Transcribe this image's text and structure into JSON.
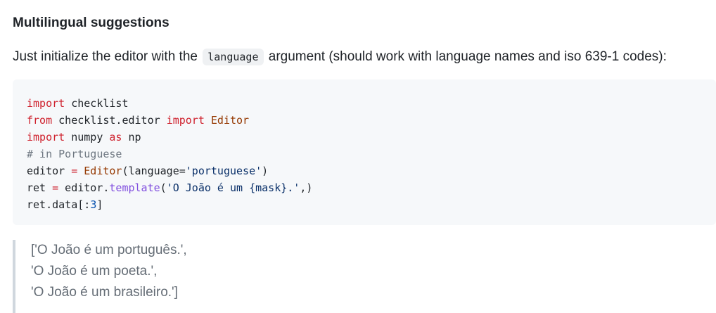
{
  "heading": "Multilingual suggestions",
  "paragraph": {
    "before": "Just initialize the editor with the",
    "code": "language",
    "after": "argument (should work with language names and iso 639-1 codes):"
  },
  "code_lines": [
    [
      {
        "t": "import",
        "c": "kw"
      },
      {
        "t": " checklist",
        "c": ""
      }
    ],
    [
      {
        "t": "from",
        "c": "kw"
      },
      {
        "t": " checklist.editor ",
        "c": ""
      },
      {
        "t": "import",
        "c": "kw"
      },
      {
        "t": " ",
        "c": ""
      },
      {
        "t": "Editor",
        "c": "cls"
      }
    ],
    [
      {
        "t": "import",
        "c": "kw"
      },
      {
        "t": " numpy ",
        "c": ""
      },
      {
        "t": "as",
        "c": "kw"
      },
      {
        "t": " np",
        "c": ""
      }
    ],
    [
      {
        "t": "# in Portuguese",
        "c": "cmt"
      }
    ],
    [
      {
        "t": "editor ",
        "c": ""
      },
      {
        "t": "=",
        "c": "kw"
      },
      {
        "t": " ",
        "c": ""
      },
      {
        "t": "Editor",
        "c": "cls"
      },
      {
        "t": "(language=",
        "c": ""
      },
      {
        "t": "'portuguese'",
        "c": "str"
      },
      {
        "t": ")",
        "c": ""
      }
    ],
    [
      {
        "t": "ret ",
        "c": ""
      },
      {
        "t": "=",
        "c": "kw"
      },
      {
        "t": " editor.",
        "c": ""
      },
      {
        "t": "template",
        "c": "fn"
      },
      {
        "t": "(",
        "c": ""
      },
      {
        "t": "'O João é um {mask}.'",
        "c": "str"
      },
      {
        "t": ",)",
        "c": ""
      }
    ],
    [
      {
        "t": "ret.data[:",
        "c": ""
      },
      {
        "t": "3",
        "c": "num"
      },
      {
        "t": "]",
        "c": ""
      }
    ]
  ],
  "output_lines": [
    "['O João é um português.',",
    "'O João é um poeta.',",
    "'O João é um brasileiro.']"
  ]
}
